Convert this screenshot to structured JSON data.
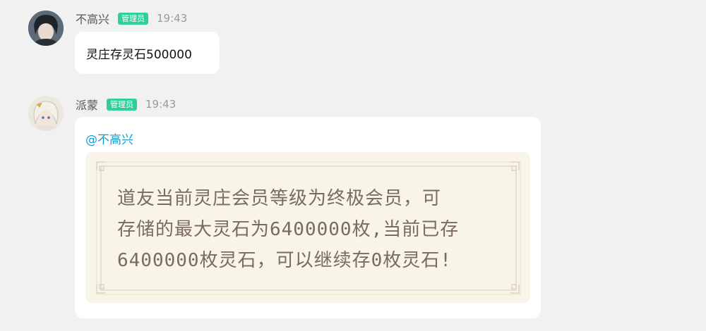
{
  "messages": [
    {
      "sender": "不高兴",
      "badge": "管理员",
      "time": "19:43",
      "text": "灵庄存灵石500000"
    },
    {
      "sender": "派蒙",
      "badge": "管理员",
      "time": "19:43",
      "mention": "@不高兴",
      "card_lines": [
        "道友当前灵庄会员等级为终极会员，可",
        "存储的最大灵石为6400000枚,当前已存",
        "6400000枚灵石，可以继续存0枚灵石!"
      ]
    }
  ],
  "colors": {
    "background": "#f1f1f1",
    "badge": "#2fcf9c",
    "mention": "#1d9bd1",
    "card_bg": "#f8f4e8",
    "card_text": "#7a6a62"
  }
}
